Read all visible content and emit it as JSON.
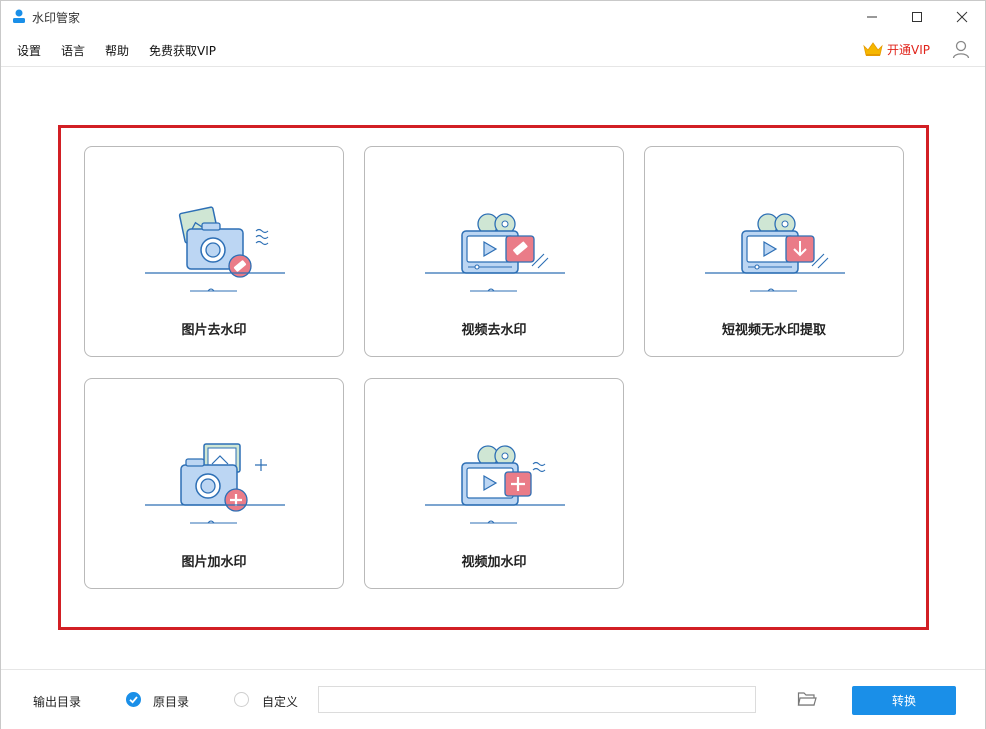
{
  "window": {
    "title": "水印管家"
  },
  "menu": {
    "items": [
      "设置",
      "语言",
      "帮助",
      "免费获取VIP"
    ],
    "vip_label": "开通VIP"
  },
  "features": [
    {
      "label": "图片去水印",
      "icon": "photo-remove-watermark-icon"
    },
    {
      "label": "视频去水印",
      "icon": "video-remove-watermark-icon"
    },
    {
      "label": "短视频无水印提取",
      "icon": "short-video-extract-icon"
    },
    {
      "label": "图片加水印",
      "icon": "photo-add-watermark-icon"
    },
    {
      "label": "视频加水印",
      "icon": "video-add-watermark-icon"
    }
  ],
  "output": {
    "label": "输出目录",
    "option_original": "原目录",
    "option_custom": "自定义",
    "selected": "原目录",
    "path_value": "",
    "convert_label": "转换"
  },
  "colors": {
    "accent": "#1a8fe8",
    "highlight": "#d21f24",
    "vip": "#e0241b"
  }
}
